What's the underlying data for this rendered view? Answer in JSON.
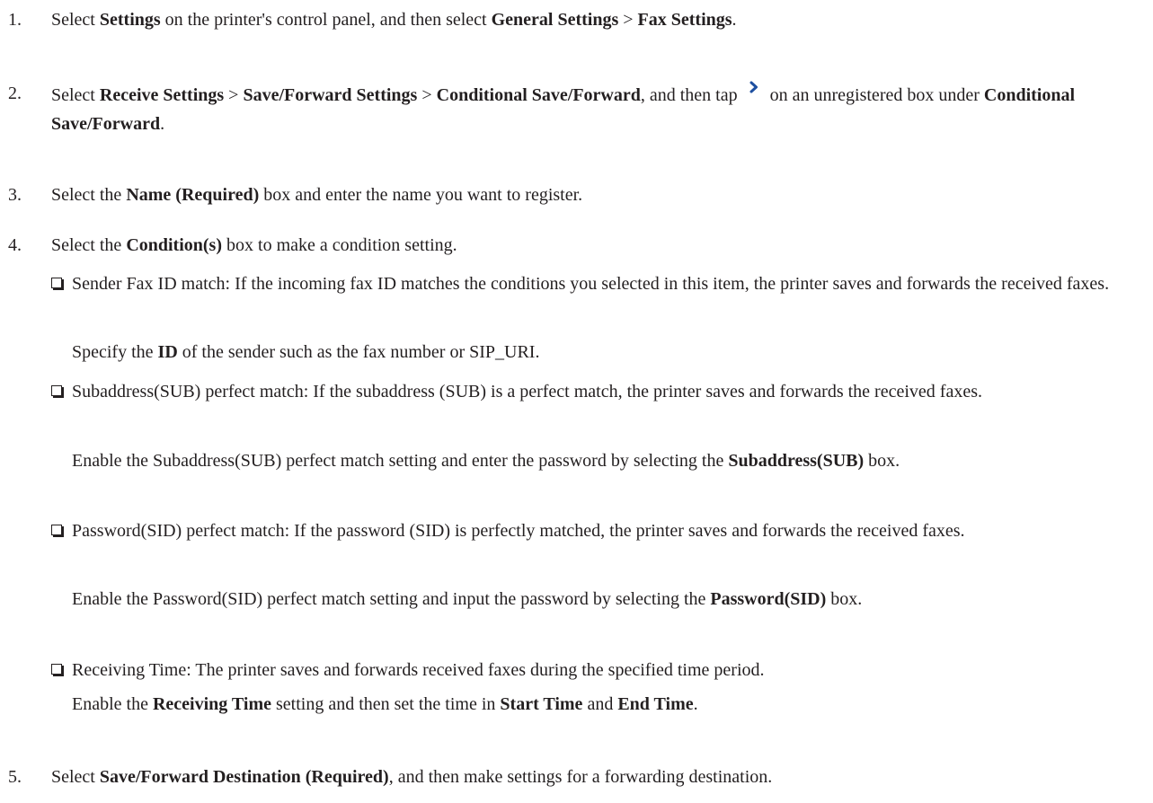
{
  "steps": [
    {
      "num": "1.",
      "parts": [
        "Select ",
        "Settings",
        " on the printer's control panel, and then select ",
        "General Settings",
        " > ",
        "Fax Settings",
        "."
      ]
    },
    {
      "num": "2.",
      "parts_a": [
        "Select ",
        "Receive Settings",
        " > ",
        "Save/Forward Settings",
        " > ",
        "Conditional Save/Forward",
        ", and then tap "
      ],
      "icon": "chevron-right-icon",
      "parts_b": [
        " on an unregistered box under ",
        "Conditional Save/Forward",
        "."
      ]
    },
    {
      "num": "3.",
      "parts": [
        "Select the ",
        "Name (Required)",
        " box and enter the name you want to register."
      ]
    },
    {
      "num": "4.",
      "parts": [
        "Select the ",
        "Condition(s)",
        " box to make a condition setting."
      ]
    },
    {
      "num": "5.",
      "parts": [
        "Select ",
        "Save/Forward Destination (Required)",
        ", and then make settings for a forwarding destination."
      ]
    }
  ],
  "conditions": [
    {
      "text": "Sender Fax ID match: If the incoming fax ID matches the conditions you selected in this item, the printer saves and forwards the received faxes.",
      "note": [
        "Specify the ",
        "ID",
        " of the sender such as the fax number or SIP_URI."
      ]
    },
    {
      "text": "Subaddress(SUB) perfect match: If the subaddress (SUB) is a perfect match, the printer saves and forwards the received faxes.",
      "note": [
        "Enable the Subaddress(SUB) perfect match setting and enter the password by selecting the ",
        "Subaddress(SUB)",
        " box."
      ]
    },
    {
      "text": "Password(SID) perfect match: If the password (SID) is perfectly matched, the printer saves and forwards the received faxes.",
      "note": [
        "Enable the Password(SID) perfect match setting and input the password by selecting the ",
        "Password(SID)",
        " box."
      ]
    },
    {
      "text": "Receiving Time: The printer saves and forwards received faxes during the specified time period.",
      "note": [
        "Enable the ",
        "Receiving Time",
        " setting and then set the time in ",
        "Start Time",
        " and ",
        "End Time",
        "."
      ]
    }
  ],
  "colors": {
    "text": "#231f20",
    "icon": "#1e4fa0"
  }
}
